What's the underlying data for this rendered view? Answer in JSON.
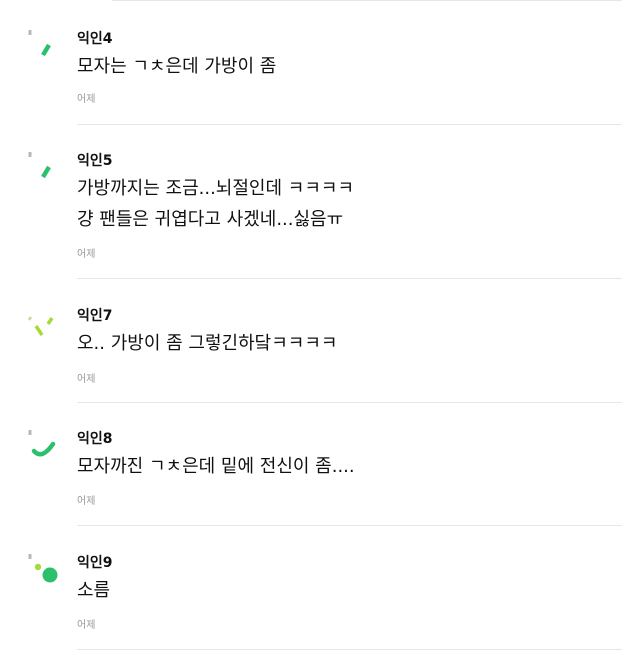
{
  "comments": [
    {
      "author": "익인4",
      "lines": [
        "모자는 ㄱㅊ은데 가방이 좀"
      ],
      "time": "어제",
      "avatar": "green-slash-icon"
    },
    {
      "author": "익인5",
      "lines": [
        "가방까지는 조금...뇌절인데 ㅋㅋㅋㅋ",
        "걍 팬들은 귀엽다고 사겠네...싫음ㅠ"
      ],
      "time": "어제",
      "avatar": "green-slash-icon"
    },
    {
      "author": "익인7",
      "lines": [
        "오.. 가방이 좀 그렇긴하닼ㅋㅋㅋㅋ"
      ],
      "time": "어제",
      "avatar": "lime-strokes-icon"
    },
    {
      "author": "익인8",
      "lines": [
        "모자까진 ㄱㅊ은데 밑에 전신이 좀...."
      ],
      "time": "어제",
      "avatar": "green-arc-icon"
    },
    {
      "author": "익인9",
      "lines": [
        "소름"
      ],
      "time": "어제",
      "avatar": "green-dots-icon"
    }
  ],
  "colors": {
    "accent_green": "#2cbf6c",
    "lime": "#a6d93a",
    "timestamp": "#9a9a9a",
    "divider": "#e6e6e6"
  }
}
